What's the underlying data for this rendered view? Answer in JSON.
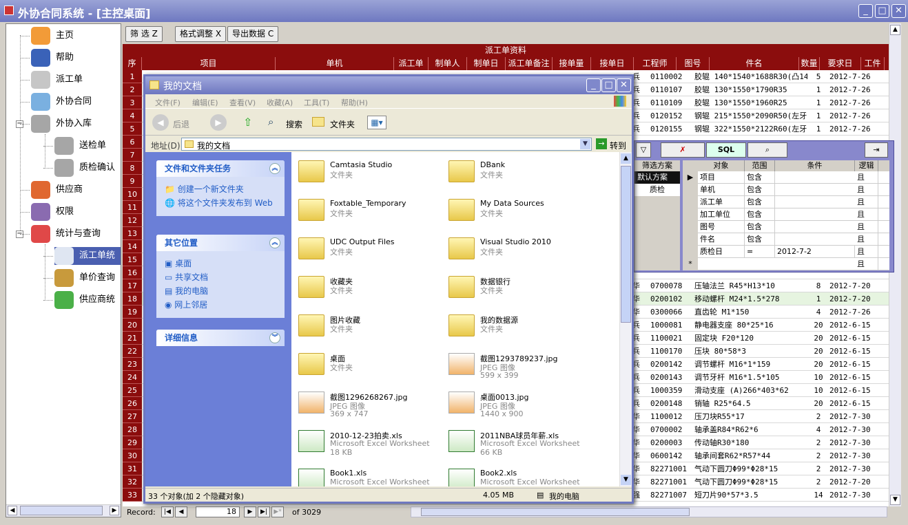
{
  "window": {
    "title": "外协合同系统 - [主控桌面]"
  },
  "tree": [
    {
      "label": "主页",
      "icon": "home-icon"
    },
    {
      "label": "帮助",
      "icon": "help-icon"
    },
    {
      "label": "派工单",
      "icon": "edit-icon"
    },
    {
      "label": "外协合同",
      "icon": "contract-icon"
    },
    {
      "label": "外协入库",
      "icon": "cart-icon"
    },
    {
      "label": "送检单",
      "icon": "cart-icon"
    },
    {
      "label": "质检确认",
      "icon": "cart-icon"
    },
    {
      "label": "供应商",
      "icon": "truck-icon"
    },
    {
      "label": "权限",
      "icon": "users-icon"
    },
    {
      "label": "统计与查询",
      "icon": "pie-icon"
    },
    {
      "label": "派工单统",
      "icon": "report-icon"
    },
    {
      "label": "单价查询",
      "icon": "money-icon"
    },
    {
      "label": "供应商统",
      "icon": "chart-icon"
    }
  ],
  "toolbar": {
    "filter": "筛 选 Z",
    "format": "格式调整 X",
    "export": "导出数据 C"
  },
  "grid": {
    "group_title": "派工单资料",
    "columns": [
      "序",
      "项目",
      "单机",
      "派工单",
      "制单人",
      "制单日",
      "派工单备注",
      "接单量",
      "接单日",
      "工程师",
      "图号",
      "件名",
      "数量",
      "要求日",
      "工件"
    ],
    "rows": [
      [
        "兵",
        "0110002",
        "胶辊 140*1540*1688R30(凸14",
        "5",
        "2012-7-26"
      ],
      [
        "兵",
        "0110107",
        "胶辊 130*1550*1790R35",
        "1",
        "2012-7-26"
      ],
      [
        "兵",
        "0110109",
        "胶辊 130*1550*1960R25",
        "1",
        "2012-7-26"
      ],
      [
        "兵",
        "0120152",
        "钢辊 215*1550*2090R50(左牙)",
        "1",
        "2012-7-26"
      ],
      [
        "兵",
        "0120155",
        "钢辊 322*1550*2122R60(左牙",
        "1",
        "2012-7-26"
      ],
      [
        "",
        "",
        "",
        "",
        ""
      ],
      [
        "",
        "",
        "",
        "",
        ""
      ],
      [
        "",
        "",
        "",
        "",
        ""
      ],
      [
        "",
        "",
        "",
        "",
        ""
      ],
      [
        "",
        "",
        "",
        "",
        ""
      ],
      [
        "",
        "",
        "",
        "",
        ""
      ],
      [
        "",
        "",
        "",
        "",
        ""
      ],
      [
        "",
        "",
        "",
        "",
        ""
      ],
      [
        "",
        "",
        "",
        "",
        ""
      ],
      [
        "",
        "",
        "",
        "",
        ""
      ],
      [
        "",
        "",
        "",
        "",
        ""
      ],
      [
        "华",
        "0700078",
        "压轴法兰 R45*H13*10",
        "8",
        "2012-7-20"
      ],
      [
        "华",
        "0200102",
        "移动螺杆 M24*1.5*278",
        "1",
        "2012-7-20"
      ],
      [
        "华",
        "0300066",
        "直齿轮 M1*150",
        "4",
        "2012-7-26"
      ],
      [
        "兵",
        "1000081",
        "静电器支座 80*25*16",
        "20",
        "2012-6-15"
      ],
      [
        "兵",
        "1100021",
        "固定块 F20*120",
        "20",
        "2012-6-15"
      ],
      [
        "兵",
        "1100170",
        "压块 80*58*3",
        "20",
        "2012-6-15"
      ],
      [
        "兵",
        "0200142",
        "调节螺杆 M16*1*159",
        "20",
        "2012-6-15"
      ],
      [
        "兵",
        "0200143",
        "调节牙杆 M16*1.5*105",
        "10",
        "2012-6-15"
      ],
      [
        "兵",
        "1000359",
        "滑动支座 (A)266*403*62",
        "10",
        "2012-6-15"
      ],
      [
        "兵",
        "0200148",
        "销轴 R25*64.5",
        "20",
        "2012-6-15"
      ],
      [
        "华",
        "1100012",
        "压刀块R55*17",
        "2",
        "2012-7-30"
      ],
      [
        "华",
        "0700002",
        "轴承盖R84*R62*6",
        "4",
        "2012-7-30"
      ],
      [
        "华",
        "0200003",
        "传动轴R30*180",
        "2",
        "2012-7-30"
      ],
      [
        "华",
        "0600142",
        "轴承间套R62*R57*44",
        "2",
        "2012-7-30"
      ],
      [
        "华",
        "82271001",
        "气动下圆刀Φ99*Φ28*15",
        "2",
        "2012-7-30"
      ],
      [
        "华",
        "82271001",
        "气动下圆刀Φ99*Φ28*15",
        "2",
        "2012-7-20"
      ],
      [
        "强",
        "82271007",
        "短刀片90*57*3.5",
        "14",
        "2012-7-30"
      ]
    ]
  },
  "status": {
    "record_label": "Record:",
    "current": "18",
    "of_text": "of  3029"
  },
  "filter_panel": {
    "buttons": [
      "SQL"
    ],
    "scheme_header": "筛选方案",
    "schemes": [
      "默认方案",
      "质检"
    ],
    "columns": [
      "对象",
      "范围",
      "条件",
      "逻辑"
    ],
    "rows": [
      [
        "项目",
        "包含",
        "",
        "且"
      ],
      [
        "单机",
        "包含",
        "",
        "且"
      ],
      [
        "派工单",
        "包含",
        "",
        "且"
      ],
      [
        "加工单位",
        "包含",
        "",
        "且"
      ],
      [
        "图号",
        "包含",
        "",
        "且"
      ],
      [
        "件名",
        "包含",
        "",
        "且"
      ],
      [
        "质检日",
        "=",
        "2012-7-2",
        "且"
      ],
      [
        "",
        "",
        "",
        "且"
      ]
    ]
  },
  "explorer": {
    "title": "我的文档",
    "menu": [
      "文件(F)",
      "编辑(E)",
      "查看(V)",
      "收藏(A)",
      "工具(T)",
      "帮助(H)"
    ],
    "back": "后退",
    "search": "搜索",
    "folders": "文件夹",
    "address_label": "地址(D)",
    "address": "我的文档",
    "go": "转到",
    "tasks": {
      "title": "文件和文件夹任务",
      "items": [
        "创建一个新文件夹",
        "将这个文件夹发布到 Web"
      ]
    },
    "places": {
      "title": "其它位置",
      "items": [
        "桌面",
        "共享文档",
        "我的电脑",
        "网上邻居"
      ]
    },
    "details": {
      "title": "详细信息"
    },
    "files": [
      {
        "name": "Camtasia Studio",
        "type": "文件夹",
        "kind": "folder"
      },
      {
        "name": "DBank",
        "type": "文件夹",
        "kind": "folder"
      },
      {
        "name": "Foxtable_Temporary",
        "type": "文件夹",
        "kind": "folder"
      },
      {
        "name": "My Data Sources",
        "type": "文件夹",
        "kind": "folder"
      },
      {
        "name": "UDC Output Files",
        "type": "文件夹",
        "kind": "folder"
      },
      {
        "name": "Visual Studio 2010",
        "type": "文件夹",
        "kind": "folder"
      },
      {
        "name": "收藏夹",
        "type": "文件夹",
        "kind": "folder"
      },
      {
        "name": "数据银行",
        "type": "文件夹",
        "kind": "folder"
      },
      {
        "name": "图片收藏",
        "type": "文件夹",
        "kind": "folder"
      },
      {
        "name": "我的数据源",
        "type": "文件夹",
        "kind": "folder"
      },
      {
        "name": "桌面",
        "type": "文件夹",
        "kind": "folder"
      },
      {
        "name": "截图1293789237.jpg",
        "type": "JPEG 图像",
        "size": "599 x 399",
        "kind": "image"
      },
      {
        "name": "截图1296268267.jpg",
        "type": "JPEG 图像",
        "size": "369 x 747",
        "kind": "image"
      },
      {
        "name": "桌面0013.jpg",
        "type": "JPEG 图像",
        "size": "1440 x 900",
        "kind": "image"
      },
      {
        "name": "2010-12-23拍卖.xls",
        "type": "Microsoft Excel Worksheet",
        "size": "18 KB",
        "kind": "excel"
      },
      {
        "name": "2011NBA球员年薪.xls",
        "type": "Microsoft Excel Worksheet",
        "size": "66 KB",
        "kind": "excel"
      },
      {
        "name": "Book1.xls",
        "type": "Microsoft Excel Worksheet",
        "size": "",
        "kind": "excel"
      },
      {
        "name": "Book2.xls",
        "type": "Microsoft Excel Worksheet",
        "size": "",
        "kind": "excel"
      }
    ],
    "status_objects": "33 个对象(加 2 个隐藏对象)",
    "status_size": "4.05 MB",
    "status_location": "我的电脑"
  }
}
